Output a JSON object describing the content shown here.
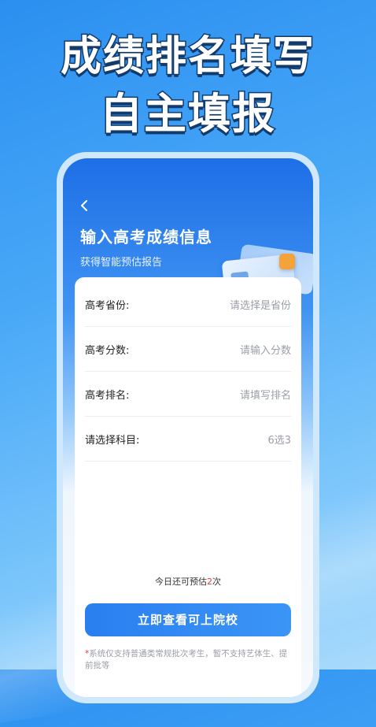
{
  "promo": {
    "headline_line1": "成绩排名填写",
    "headline_line2": "自主填报"
  },
  "screen": {
    "back_icon": "chevron-left-icon",
    "title": "输入高考成绩信息",
    "subtitle": "获得智能预估报告"
  },
  "form": {
    "rows": [
      {
        "label": "高考省份:",
        "placeholder": "请选择是省份"
      },
      {
        "label": "高考分数:",
        "placeholder": "请输入分数"
      },
      {
        "label": "高考排名:",
        "placeholder": "请填写排名"
      },
      {
        "label": "请选择科目:",
        "placeholder": "6选3"
      }
    ]
  },
  "quota": {
    "prefix": "今日还可预估",
    "count": "2",
    "suffix": "次"
  },
  "submit": {
    "label": "立即查看可上院校"
  },
  "notice": {
    "star": "*",
    "text": "系统仅支持普通类常规批次考生，暂不支持艺体生、提前批等"
  },
  "colors": {
    "accent": "#2a7ff0",
    "quota_count": "#e53935",
    "headline_stroke": "#123a6b"
  }
}
